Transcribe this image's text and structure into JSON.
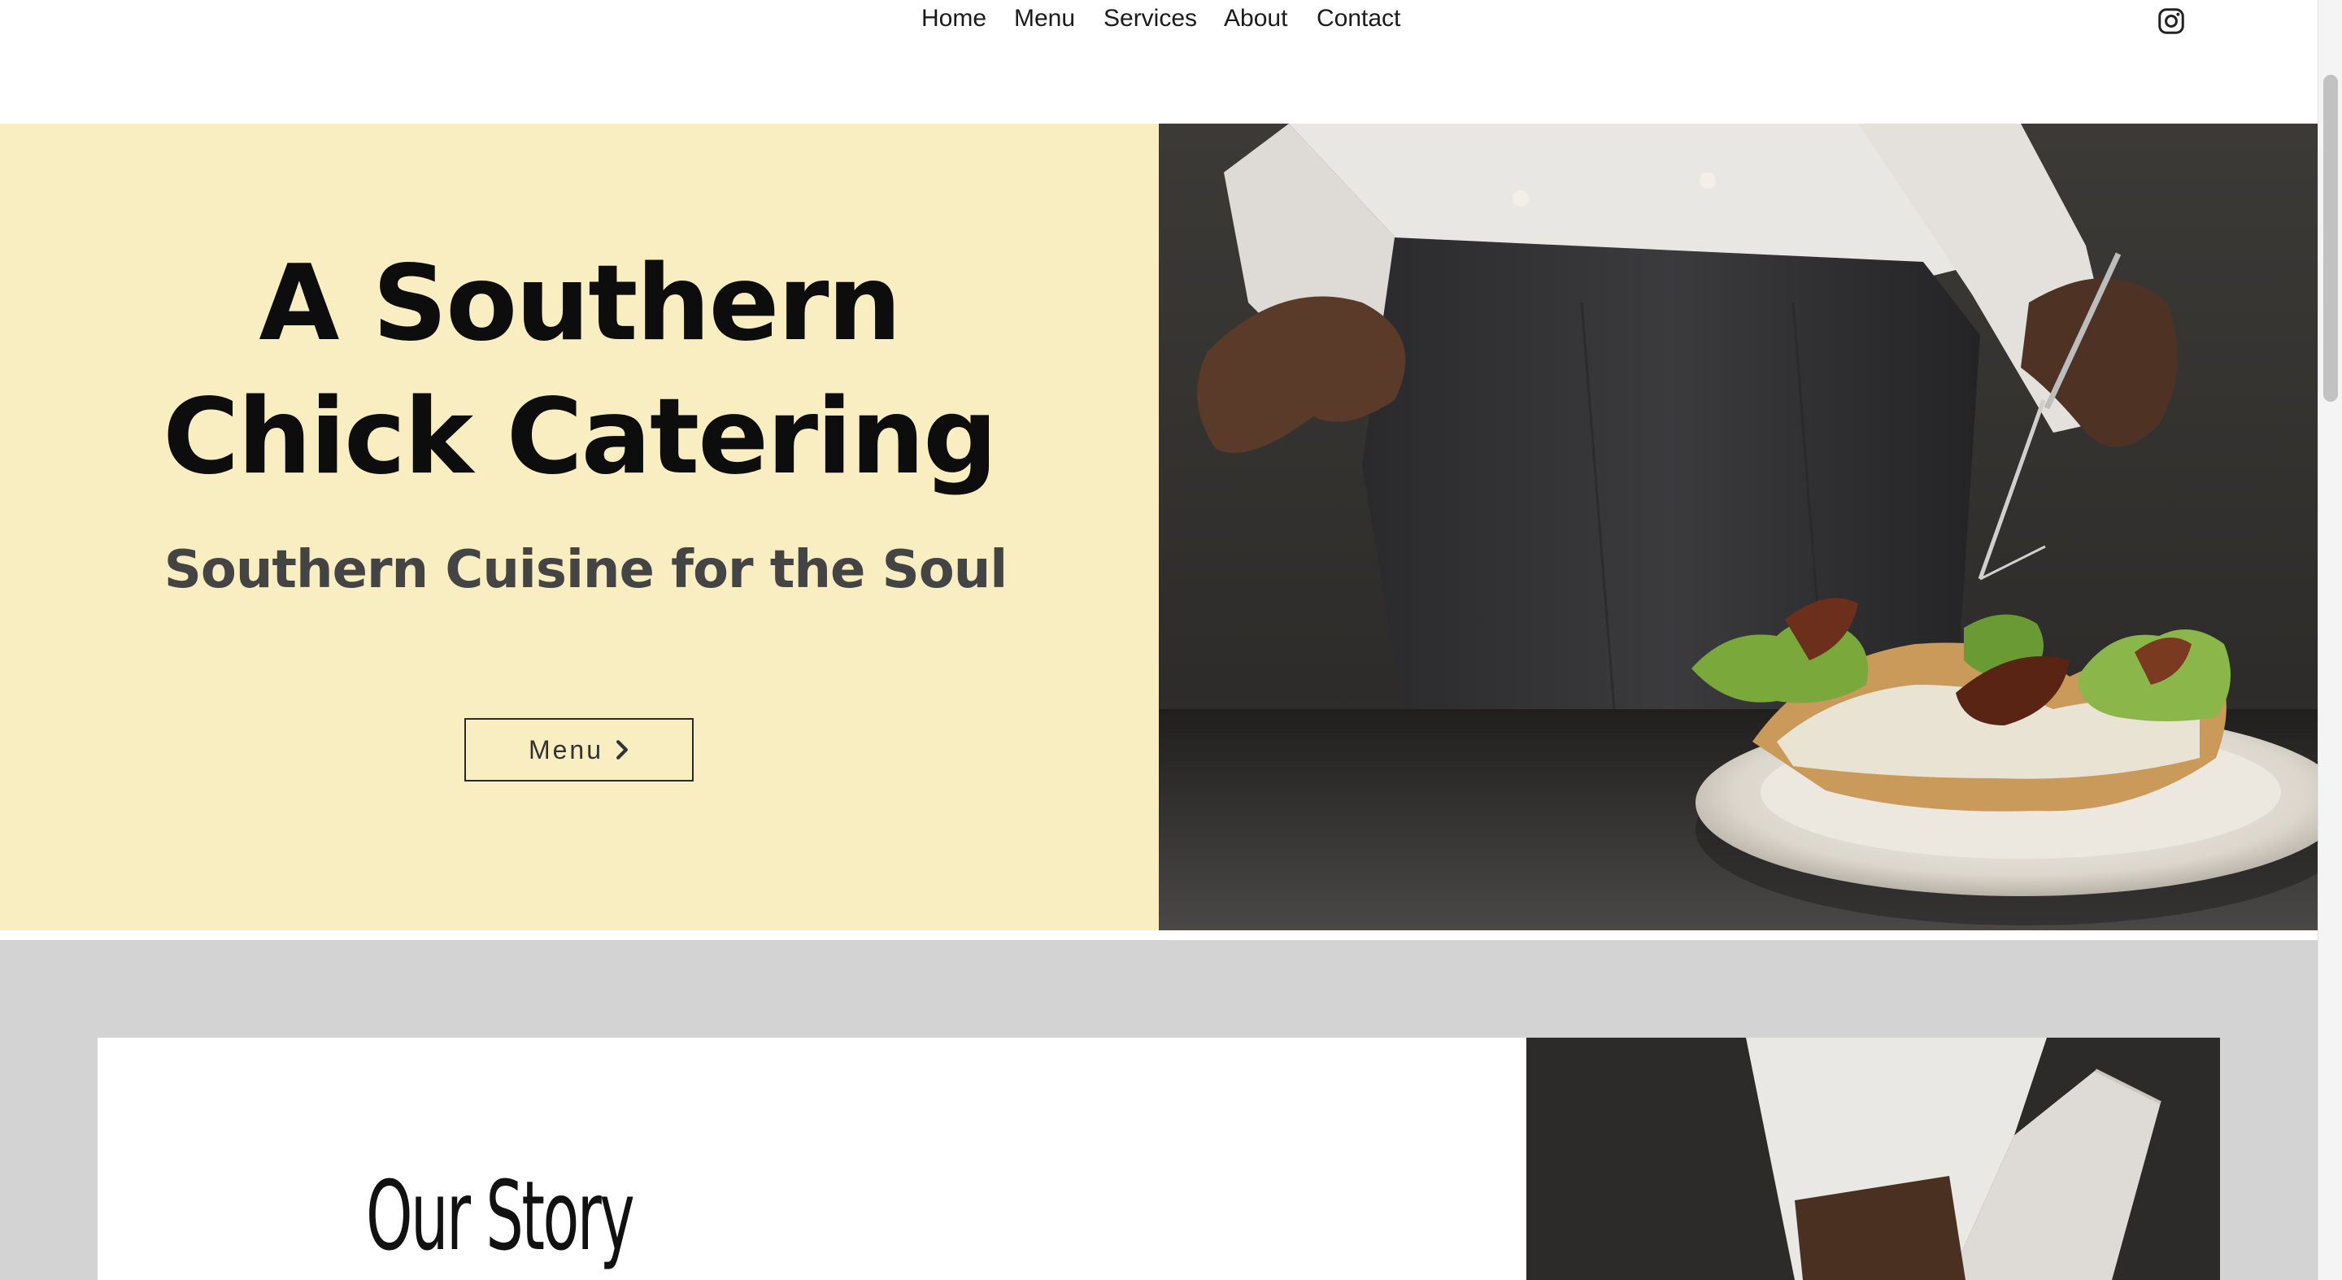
{
  "nav": {
    "items": [
      "Home",
      "Menu",
      "Services",
      "About",
      "Contact"
    ],
    "social_icon": "instagram-icon"
  },
  "hero": {
    "title_line1": "A Southern",
    "title_line2": "Chick Catering",
    "subtitle": "Southern Cuisine for the Soul",
    "button_label": "Menu",
    "button_icon": "chevron-right-icon",
    "background_color": "#f9eec2",
    "image": "chef plating a sandwich with tweezers"
  },
  "story": {
    "title": "Our Story",
    "band_color": "#d3d3d3",
    "image": "chef in white jacket"
  }
}
